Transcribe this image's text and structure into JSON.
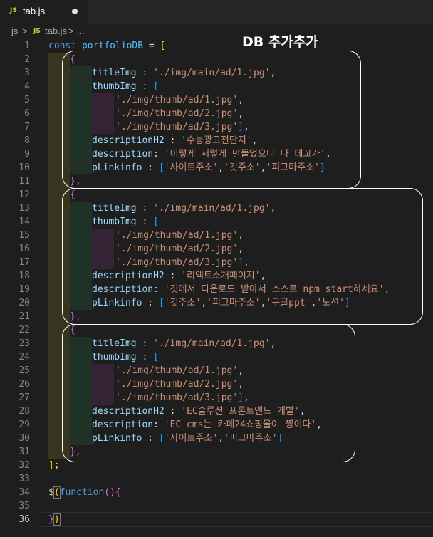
{
  "tab": {
    "icon": "JS",
    "filename": "tab.js"
  },
  "breadcrumb": {
    "folder": "js",
    "sep": ">",
    "file_icon": "JS",
    "file": "tab.js",
    "more": "..."
  },
  "annotation": "DB 추가추가",
  "line_numbers": [
    "1",
    "2",
    "3",
    "4",
    "5",
    "6",
    "7",
    "8",
    "9",
    "10",
    "11",
    "12",
    "13",
    "14",
    "15",
    "16",
    "17",
    "18",
    "19",
    "20",
    "21",
    "22",
    "23",
    "24",
    "25",
    "26",
    "27",
    "28",
    "29",
    "30",
    "31",
    "32",
    "33",
    "34",
    "35",
    "36"
  ],
  "code": {
    "l1": {
      "kw": "const",
      "var": "portfolioDB",
      "eq": "=",
      "br": "["
    },
    "obj_open": "{",
    "obj_close": "},",
    "title_key": "titleImg",
    "title_val": "'./img/main/ad/1.jpg'",
    "thumb_key": "thumbImg",
    "arr_open": "[",
    "thumb1": "'./img/thumb/ad/1.jpg'",
    "thumb2": "'./img/thumb/ad/2.jpg'",
    "thumb3": "'./img/thumb/ad/3.jpg'",
    "arr_close": "]",
    "desch2_key": "descriptionH2",
    "desc_key": "description",
    "plink_key": "pLinkinfo",
    "colon": " : ",
    "colon2": ": ",
    "comma": ",",
    "o1": {
      "h2": "'수능광고전단지'",
      "desc": "'이렇게 저렇게 만들었으니 나 데꼬가'",
      "links": [
        "'사이트주소'",
        "'깃주소'",
        "'피그마주소'"
      ]
    },
    "o2": {
      "h2": "'리액트소개페이지'",
      "desc": "'깃에서 다운로드 받아서 소스로 npm start하세요'",
      "links": [
        "'깃주소'",
        "'피그마주소'",
        "'구글ppt'",
        "'노션'"
      ]
    },
    "o3": {
      "h2": "'EC솔루션 프론트엔드 개발'",
      "desc": "'EC cms는 카페24쇼핑몰이 짱이다'",
      "links": [
        "'사이트주소'",
        "'피그마주소'"
      ]
    },
    "end_arr": "];",
    "l34": {
      "dollar": "$",
      "po": "(",
      "fn": "function",
      "args": "()",
      "brace": "{"
    },
    "l36": {
      "brace": "}",
      "pc": ")"
    }
  }
}
